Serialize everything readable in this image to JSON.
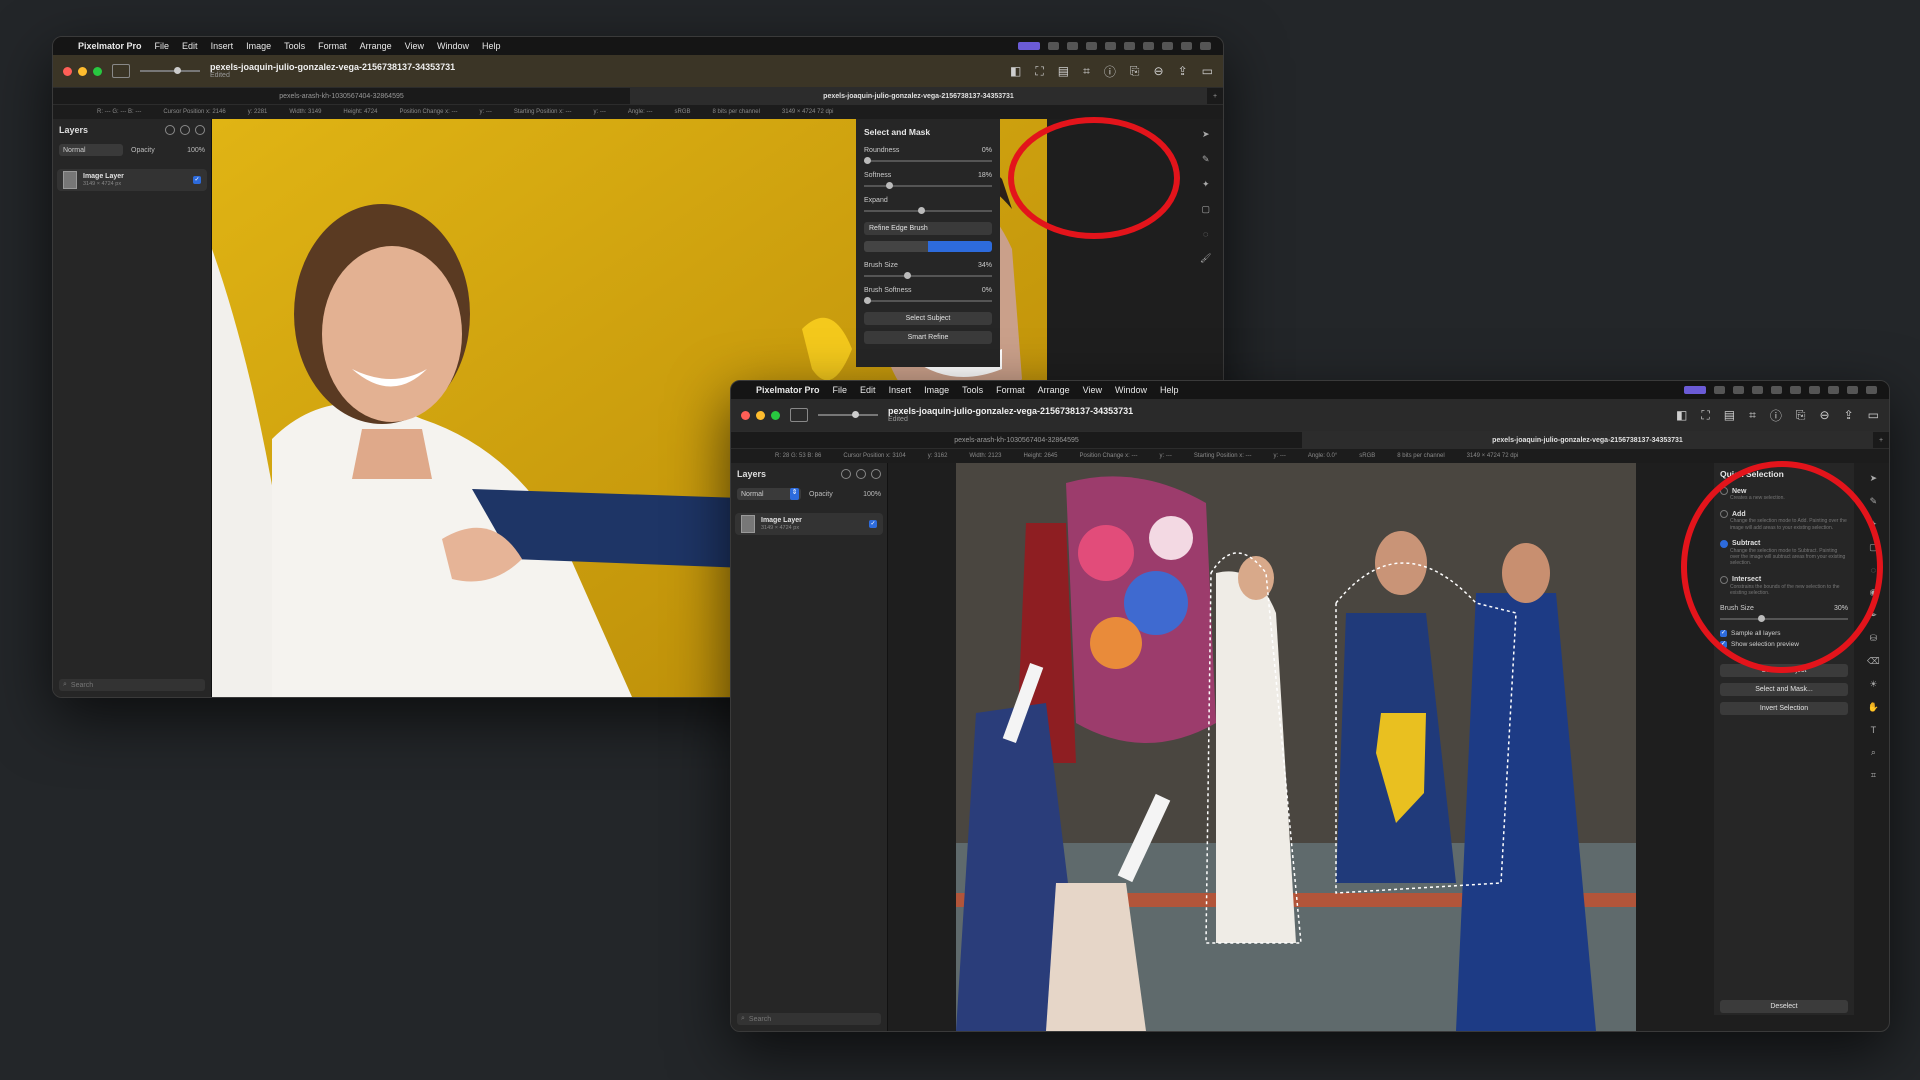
{
  "app_menu": {
    "app_name": "Pixelmator Pro",
    "items": [
      "File",
      "Edit",
      "Insert",
      "Image",
      "Tools",
      "Format",
      "Arrange",
      "View",
      "Window",
      "Help"
    ]
  },
  "window1": {
    "doc_title": "pexels-joaquin-julio-gonzalez-vega-2156738137-34353731",
    "doc_status": "Edited",
    "tabs": [
      "pexels-arash-kh-1030567404-32864595",
      "pexels-joaquin-julio-gonzalez-vega-2156738137-34353731"
    ],
    "info": [
      "R: ---  G: ---  B: ---",
      "Cursor Position x: 2146",
      "y: 2281",
      "Width: 3149",
      "Height: 4724",
      "Position Change x: ---",
      "y: ---",
      "Starting Position x: ---",
      "y: ---",
      "Angle: ---",
      "sRGB",
      "8 bits per channel",
      "3149 × 4724 72 dpi"
    ],
    "layers": {
      "title": "Layers",
      "blend": "Normal",
      "opacity_label": "Opacity",
      "opacity_value": "100%",
      "layer_name": "Image Layer",
      "layer_size": "3149 × 4724 px",
      "search_placeholder": "Search"
    },
    "panel": {
      "title": "Select and Mask",
      "roundness_label": "Roundness",
      "roundness_value": "0%",
      "softness_label": "Softness",
      "softness_value": "18%",
      "expand_label": "Expand",
      "brush_dropdown": "Refine Edge Brush",
      "brush_size_label": "Brush Size",
      "brush_size_value": "34%",
      "brush_softness_label": "Brush Softness",
      "brush_softness_value": "0%",
      "select_subject": "Select Subject",
      "smart_refine": "Smart Refine"
    }
  },
  "window2": {
    "doc_title": "pexels-joaquin-julio-gonzalez-vega-2156738137-34353731",
    "doc_status": "Edited",
    "tabs": [
      "pexels-arash-kh-1030567404-32864595",
      "pexels-joaquin-julio-gonzalez-vega-2156738137-34353731"
    ],
    "info": [
      "R: 28  G: 53  B: 86",
      "Cursor Position x: 3104",
      "y: 3162",
      "Width: 2123",
      "Height: 2645",
      "Position Change x: ---",
      "y: ---",
      "Starting Position x: ---",
      "y: ---",
      "Angle: 0.0°",
      "sRGB",
      "8 bits per channel",
      "3149 × 4724 72 dpi"
    ],
    "layers": {
      "title": "Layers",
      "blend": "Normal",
      "opacity_label": "Opacity",
      "opacity_value": "100%",
      "layer_name": "Image Layer",
      "layer_size": "3149 × 4724 px",
      "search_placeholder": "Search"
    },
    "panel": {
      "title": "Quick Selection",
      "options": [
        {
          "label": "New",
          "desc": "Creates a new selection.",
          "selected": false
        },
        {
          "label": "Add",
          "desc": "Change the selection mode to Add. Painting over the image will add areas to your existing selection.",
          "selected": false
        },
        {
          "label": "Subtract",
          "desc": "Change the selection mode to Subtract. Painting over the image will subtract areas from your existing selection.",
          "selected": true
        },
        {
          "label": "Intersect",
          "desc": "Constrains the bounds of the new selection to the existing selection.",
          "selected": false
        }
      ],
      "brush_size_label": "Brush Size",
      "brush_size_value": "30%",
      "sample_all": "Sample all layers",
      "show_preview": "Show selection preview",
      "select_subject": "Select Subject",
      "select_and_mask": "Select and Mask...",
      "invert_selection": "Invert Selection",
      "deselect": "Deselect"
    }
  },
  "accent": "#2d6bdc",
  "highlight_ring": "#e3141b"
}
